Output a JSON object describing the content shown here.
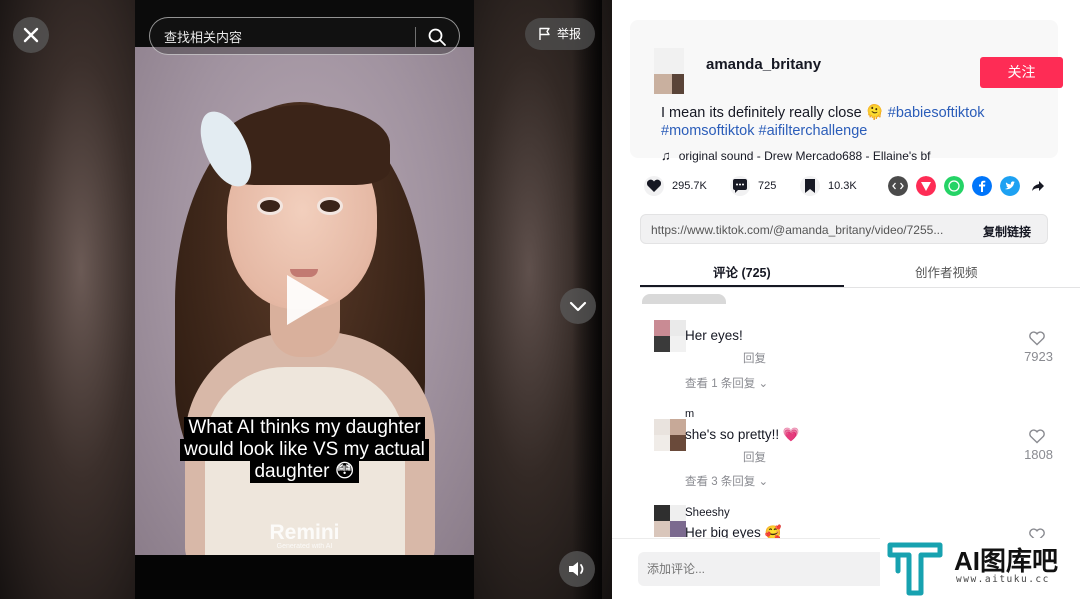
{
  "player": {
    "search_placeholder": "查找相关内容",
    "report_label": "举报",
    "caption_lines": [
      "What AI thinks my daughter",
      "would look like VS my actual",
      "daughter 😳"
    ],
    "brand": "Remini",
    "brand_sub": "Generated with AI"
  },
  "post": {
    "username": "amanda_britany",
    "follow_label": "关注",
    "description": "I mean its definitely really close 🫠",
    "hashtags": [
      "#babiesoftiktok",
      "#momsoftiktok",
      "#aifilterchallenge"
    ],
    "music": "original sound - Drew Mercado688 - Ellaine's bf"
  },
  "stats": {
    "likes": "295.7K",
    "comments": "725",
    "saves": "10.3K"
  },
  "share": {
    "icons": [
      "embed-icon",
      "send-icon",
      "whatsapp-icon",
      "facebook-icon",
      "twitter-icon",
      "share-arrow-icon"
    ],
    "colors": {
      "embed": "#4b4b4b",
      "send": "#fe2c55",
      "whatsapp": "#25d366",
      "facebook": "#0075fa",
      "twitter": "#1da1f2"
    }
  },
  "link": {
    "url": "https://www.tiktok.com/@amanda_britany/video/7255...",
    "copy_label": "复制链接"
  },
  "tabs": {
    "comments_label": "评论 (725)",
    "creator_videos_label": "创作者视频"
  },
  "comments": [
    {
      "name": "",
      "text": "Her eyes!",
      "reply_label": "回复",
      "view_replies": "查看 1 条回复",
      "likes": "7923"
    },
    {
      "name": "m",
      "text": "she's so pretty!! 💗",
      "reply_label": "回复",
      "view_replies": "查看 3 条回复",
      "likes": "1808"
    },
    {
      "name": "Sheeshy",
      "text": "Her big eyes 🥰",
      "reply_label": "",
      "view_replies": "",
      "likes": ""
    }
  ],
  "comment_input_placeholder": "添加评论...",
  "watermark": {
    "text": "AI图库吧",
    "url": "www.aituku.cc"
  },
  "colors": {
    "accent": "#fe2c55",
    "hashtag": "#2b5db9",
    "watermark_teal": "#17a2b0"
  }
}
